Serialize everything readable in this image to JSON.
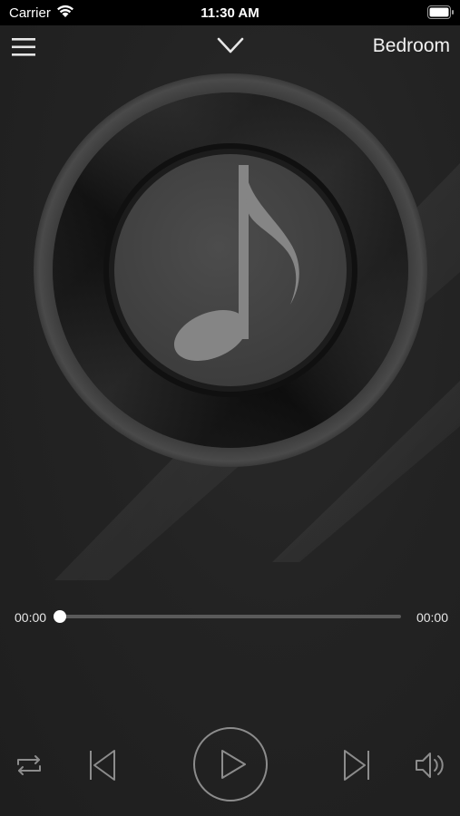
{
  "status_bar": {
    "carrier": "Carrier",
    "time": "11:30 AM",
    "wifi_icon": "wifi-icon",
    "battery_icon": "battery-icon"
  },
  "nav": {
    "menu_icon": "hamburger-menu-icon",
    "collapse_icon": "chevron-down-icon",
    "room_name": "Bedroom"
  },
  "artwork": {
    "icon": "music-note-icon"
  },
  "progress": {
    "current_time": "00:00",
    "total_time": "00:00",
    "fraction": 0
  },
  "controls": {
    "repeat_icon": "repeat-icon",
    "previous_icon": "skip-previous-icon",
    "play_icon": "play-icon",
    "next_icon": "skip-next-icon",
    "volume_icon": "volume-icon"
  },
  "colors": {
    "background": "#1e1e1e",
    "status_bar": "#000000",
    "icon_gray": "#8c8c8c",
    "note_gray": "#858585"
  }
}
